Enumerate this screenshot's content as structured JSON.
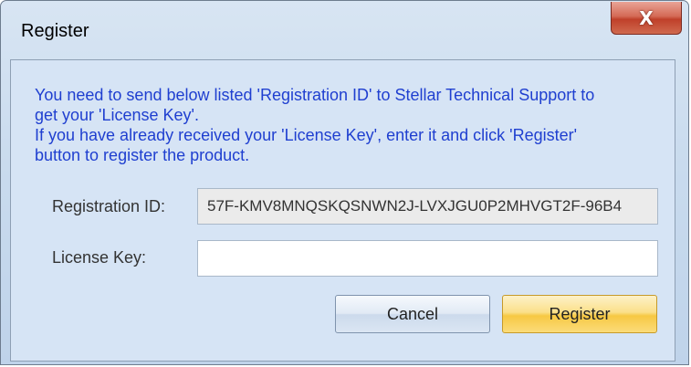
{
  "window": {
    "title": "Register",
    "close_glyph": "X"
  },
  "message": {
    "line1": "You need to send below listed 'Registration ID' to Stellar Technical Support to",
    "line2": "get your 'License Key'.",
    "line3": "If you have already received your 'License Key', enter it and click 'Register'",
    "line4": "button to register the product."
  },
  "form": {
    "registration_id_label": "Registration ID:",
    "registration_id_value": "57F-KMV8MNQSKQSNWN2J-LVXJGU0P2MHVGT2F-96B4",
    "license_key_label": "License Key:",
    "license_key_value": ""
  },
  "buttons": {
    "cancel_label": "Cancel",
    "register_label": "Register"
  },
  "icons": {
    "close": "close-icon"
  },
  "colors": {
    "message_text": "#1f3fd0",
    "register_button": "#f7c843",
    "close_button": "#c0402a"
  }
}
